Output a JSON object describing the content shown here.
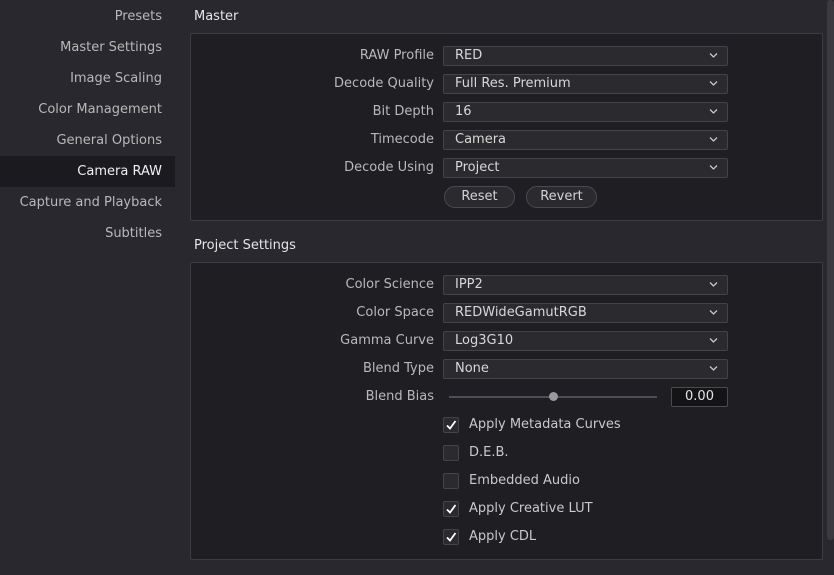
{
  "sidebar": {
    "items": [
      {
        "label": "Presets"
      },
      {
        "label": "Master Settings"
      },
      {
        "label": "Image Scaling"
      },
      {
        "label": "Color Management"
      },
      {
        "label": "General Options"
      },
      {
        "label": "Camera RAW",
        "active": true
      },
      {
        "label": "Capture and Playback"
      },
      {
        "label": "Subtitles"
      }
    ]
  },
  "master": {
    "title": "Master",
    "raw_profile": {
      "label": "RAW Profile",
      "value": "RED"
    },
    "decode_quality": {
      "label": "Decode Quality",
      "value": "Full Res. Premium"
    },
    "bit_depth": {
      "label": "Bit Depth",
      "value": "16"
    },
    "timecode": {
      "label": "Timecode",
      "value": "Camera"
    },
    "decode_using": {
      "label": "Decode Using",
      "value": "Project"
    },
    "reset_label": "Reset",
    "revert_label": "Revert"
  },
  "project": {
    "title": "Project Settings",
    "color_science": {
      "label": "Color Science",
      "value": "IPP2"
    },
    "color_space": {
      "label": "Color Space",
      "value": "REDWideGamutRGB"
    },
    "gamma_curve": {
      "label": "Gamma Curve",
      "value": "Log3G10"
    },
    "blend_type": {
      "label": "Blend Type",
      "value": "None"
    },
    "blend_bias": {
      "label": "Blend Bias",
      "value": "0.00"
    },
    "checkboxes": [
      {
        "label": "Apply Metadata Curves",
        "checked": true
      },
      {
        "label": "D.E.B.",
        "checked": false
      },
      {
        "label": "Embedded Audio",
        "checked": false
      },
      {
        "label": "Apply Creative LUT",
        "checked": true
      },
      {
        "label": "Apply CDL",
        "checked": true
      }
    ]
  },
  "icons": {
    "dropdown": "chevron-down-icon",
    "check": "checkmark-icon"
  },
  "colors": {
    "background": "#28282e",
    "panel": "#1f1f23",
    "active_item": "#1b1b1f"
  }
}
